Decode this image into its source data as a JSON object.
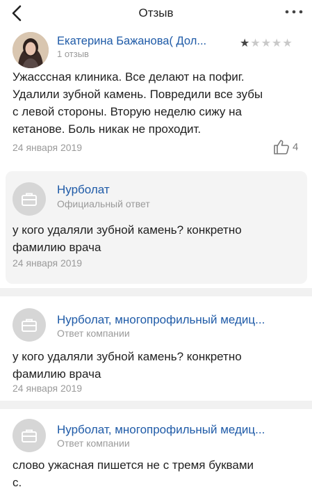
{
  "header": {
    "title": "Отзыв"
  },
  "review": {
    "author": "Екатерина Бажанова( Дол...",
    "reviews_count": "1 отзыв",
    "rating": 1,
    "rating_max": 5,
    "lines": [
      "Ужасссная клиника. Все делают на пофиг.",
      "Удалили зубной камень. Повредили все зубы",
      "с левой стороны. Вторую неделю сижу на",
      "кетанове. Боль никак не проходит."
    ],
    "date": "24 января 2019",
    "likes": "4"
  },
  "official_answer": {
    "name": "Нурболат",
    "label": "Официальный ответ",
    "lines": [
      "у кого удаляли зубной камень? конкретно",
      "фамилию врача"
    ],
    "date": "24 января 2019"
  },
  "comments": [
    {
      "name": "Нурболат, многопрофильный медиц...",
      "label": "Ответ компании",
      "lines": [
        "у кого удаляли зубной камень? конкретно",
        "фамилию врача"
      ],
      "date": "24 января 2019"
    },
    {
      "name": "Нурболат, многопрофильный медиц...",
      "label": "Ответ компании",
      "lines": [
        "слово ужасная пишется не с тремя буквами",
        "с."
      ]
    }
  ],
  "colors": {
    "link": "#1e5aa7",
    "muted": "#9a9a9a",
    "answer_bg": "#f4f4f4"
  }
}
